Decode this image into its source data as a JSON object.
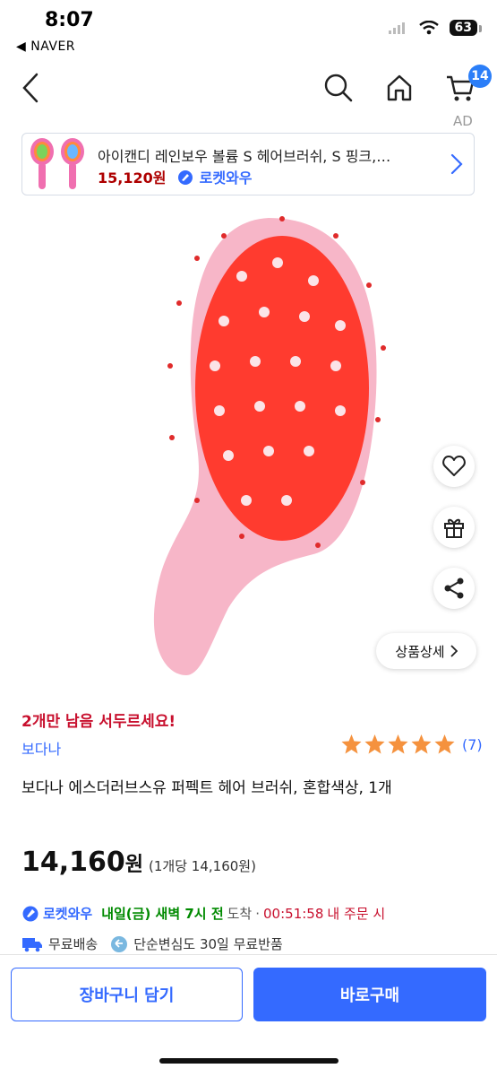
{
  "status_bar": {
    "time": "8:07",
    "back_app": "◀ NAVER",
    "battery": "63"
  },
  "nav": {
    "cart_count": "14"
  },
  "ad": {
    "label": "AD",
    "title": "아이캔디 레인보우 볼륨 S 헤어브러쉬, S 핑크,…",
    "price": "15,120원",
    "rocket": "로켓와우"
  },
  "image_panel": {
    "detail_button": "상품상세"
  },
  "product": {
    "stock_alert": "2개만 남음 서두르세요!",
    "brand": "보다나",
    "rating_stars": 5,
    "review_count": "(7)",
    "title": "보다나 에스더러브스유 퍼펙트 헤어 브러쉬, 혼합색상, 1개",
    "price": "14,160",
    "price_unit": "원",
    "unit_price": "(1개당 14,160원)"
  },
  "delivery": {
    "rocket": "로켓와우",
    "eta": "내일(금) 새벽 7시 전",
    "arrive": "도착",
    "sep": "·",
    "countdown": "00:51:58",
    "order_note": "내 주문 시",
    "free_shipping": "무료배송",
    "free_return": "단순변심도 30일 무료반품"
  },
  "actions": {
    "add_to_cart": "장바구니 담기",
    "buy_now": "바로구매"
  },
  "colors": {
    "accent": "#346aff",
    "alert": "#c8102e",
    "eta": "#008a00",
    "star": "#f5923e"
  }
}
